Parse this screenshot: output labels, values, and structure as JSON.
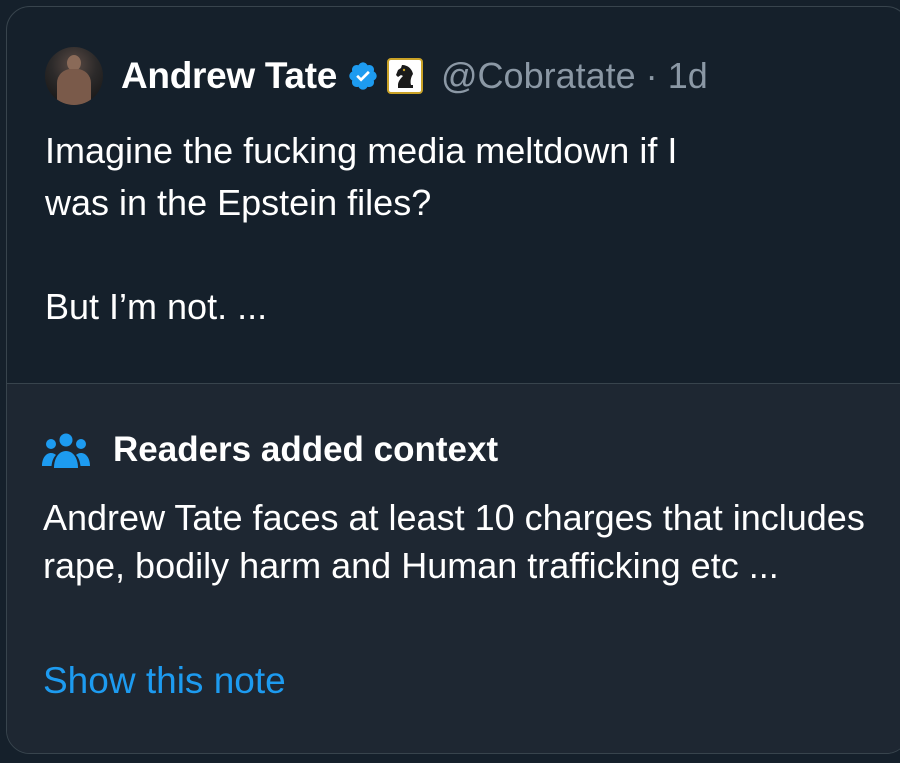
{
  "tweet": {
    "author_name": "Andrew Tate",
    "handle": "@Cobratate",
    "separator": "·",
    "time": "1d",
    "text": "Imagine the fucking media meltdown if I\nwas in the Epstein files?\n\nBut I’m not. ...",
    "icons": {
      "avatar": "profile-photo",
      "verified": "verified-badge-icon",
      "affiliation": "chess-knight-icon"
    }
  },
  "community_note": {
    "title": "Readers added context",
    "icon": "people-icon",
    "body": "Andrew Tate faces at least 10 charges that includes rape, bodily harm and Human trafficking etc ...",
    "link_label": "Show this note"
  },
  "colors": {
    "background": "#15202b",
    "note_background": "#1e2732",
    "accent": "#1d9bf0",
    "secondary_text": "#8b98a5",
    "border": "#38444d"
  }
}
